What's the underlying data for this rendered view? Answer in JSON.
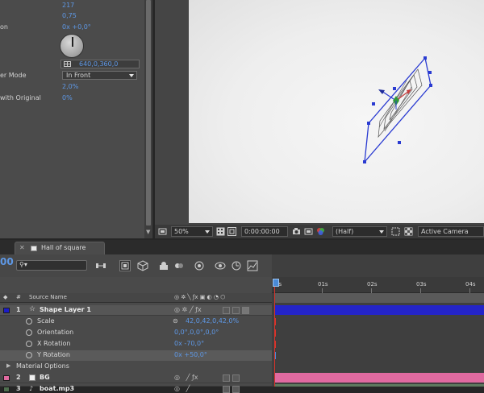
{
  "effect_controls": {
    "rows": [
      {
        "label": "",
        "value": "217"
      },
      {
        "label": "",
        "value": "0,75"
      },
      {
        "label": "on",
        "value": "0x +0,0°"
      },
      {
        "label": "",
        "value": "640,0,360,0"
      },
      {
        "label": "er Mode",
        "value": "In Front"
      },
      {
        "label": "",
        "value": "2,0%"
      },
      {
        "label": "with Original",
        "value": "0%"
      }
    ]
  },
  "viewer": {
    "zoom": "50%",
    "timecode": "0:00:00:00",
    "resolution": "(Half)",
    "camera": "Active Camera"
  },
  "timeline": {
    "tab_label": "Hall of square",
    "timecode": "00",
    "search_placeholder": "",
    "columns": {
      "num": "#",
      "source": "Source Name"
    },
    "ruler": [
      "0s",
      "01s",
      "02s",
      "03s",
      "04s"
    ],
    "layers": [
      {
        "num": "1",
        "name": "Shape Layer 1",
        "color": "#1c1cc8"
      },
      {
        "num": "2",
        "name": "BG",
        "color": "#e06aa0"
      },
      {
        "num": "3",
        "name": "boat.mp3",
        "color": "#5f7a5f"
      }
    ],
    "properties": [
      {
        "name": "Scale",
        "value": "42,0,42,0,42,0%"
      },
      {
        "name": "Orientation",
        "value": "0,0°,0,0°,0,0°"
      },
      {
        "name": "X Rotation",
        "value": "0x -70,0°"
      },
      {
        "name": "Y Rotation",
        "value": "0x +50,0°"
      }
    ],
    "material_options": "Material Options"
  }
}
